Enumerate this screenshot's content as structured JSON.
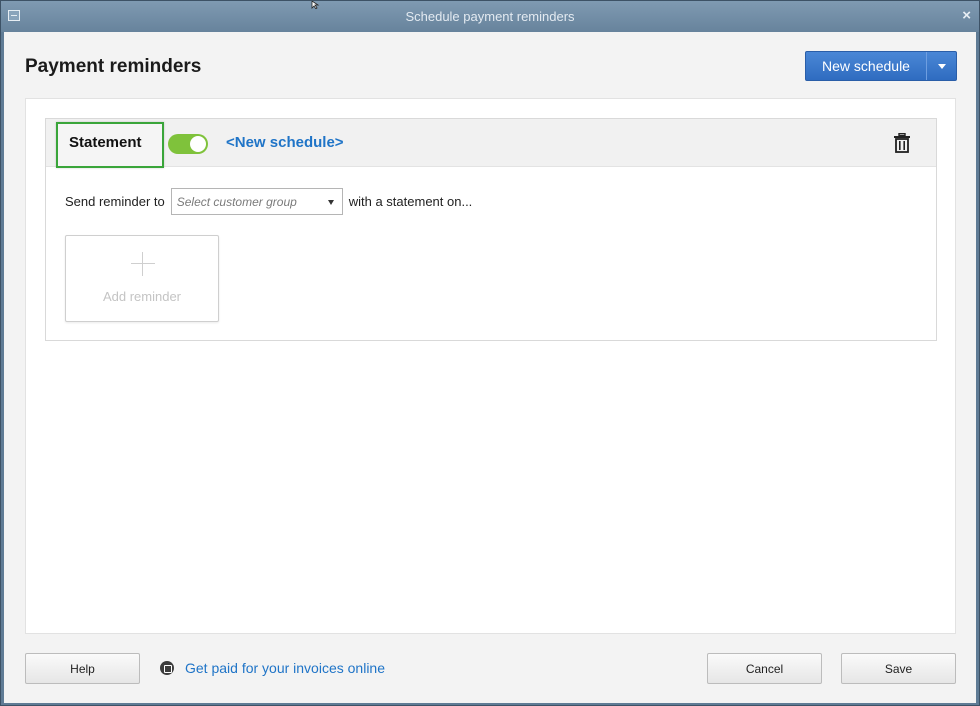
{
  "window": {
    "title": "Schedule payment reminders",
    "close_symbol": "×"
  },
  "header": {
    "title": "Payment reminders",
    "new_schedule_label": "New schedule"
  },
  "schedule": {
    "type_label": "Statement",
    "enabled": true,
    "name": "<New schedule>",
    "send_label": "Send reminder to",
    "group_placeholder": "Select customer group",
    "suffix_label": "with a statement on...",
    "add_reminder_label": "Add reminder"
  },
  "footer": {
    "help_label": "Help",
    "online_link": "Get paid for your invoices online",
    "cancel_label": "Cancel",
    "save_label": "Save"
  },
  "colors": {
    "accent": "#2f6cc0",
    "link": "#1f74c7",
    "toggle_on": "#7fc23b",
    "highlight": "#3aa53a"
  }
}
